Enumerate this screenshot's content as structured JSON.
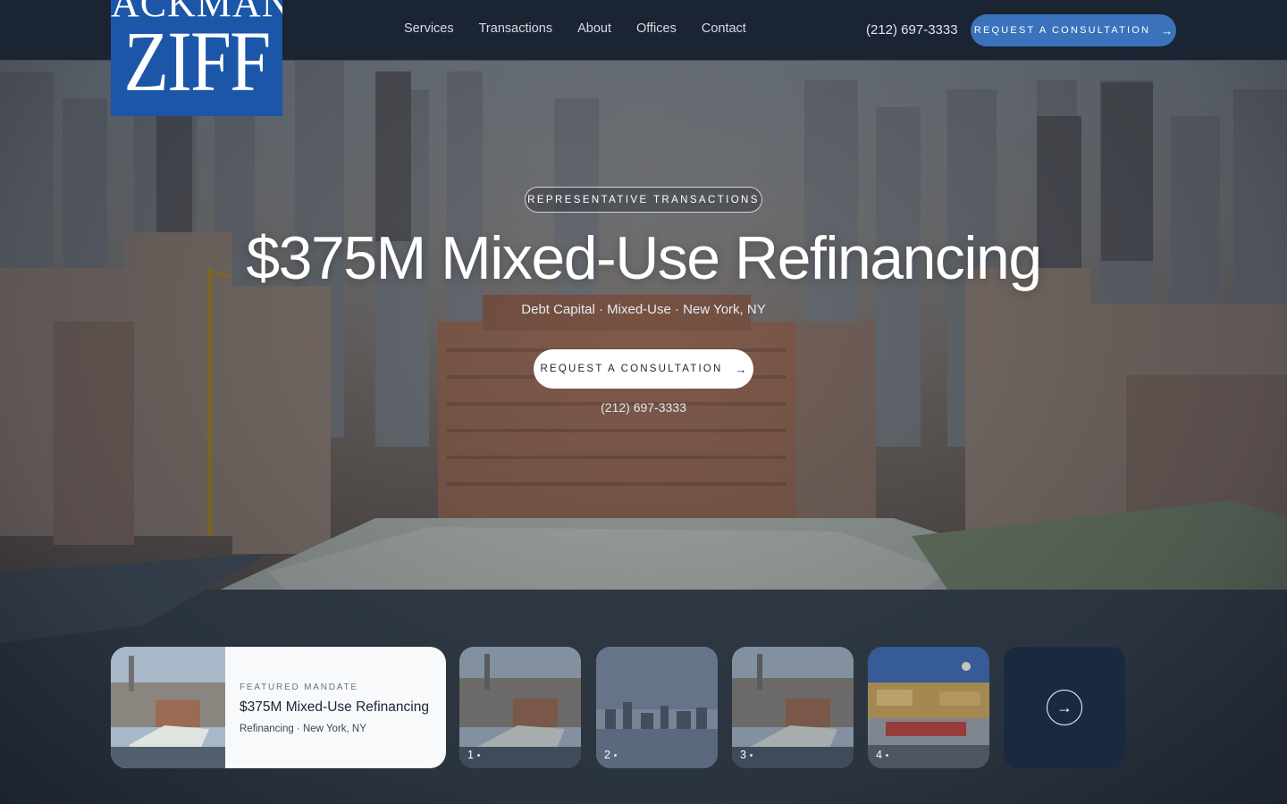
{
  "header": {
    "logo_top": "ACKMAN",
    "logo_main": "ZIFF",
    "nav": [
      {
        "label": "Services"
      },
      {
        "label": "Transactions"
      },
      {
        "label": "About"
      },
      {
        "label": "Offices"
      },
      {
        "label": "Contact"
      }
    ],
    "phone": "(212) 697-3333",
    "cta_label": "REQUEST A CONSULTATION",
    "cta_icon": "arrow-right-icon"
  },
  "hero": {
    "eyebrow": "REPRESENTATIVE TRANSACTIONS",
    "title": "$375M Mixed-Use Refinancing",
    "subtitle": "Debt Capital · Mixed-Use · New York, NY",
    "cta_label": "REQUEST A CONSULTATION",
    "phone": "(212) 697-3333"
  },
  "carousel": {
    "featured": {
      "eyebrow": "FEATURED MANDATE",
      "title": "$375M Mixed-Use Refinancing",
      "meta": "Refinancing · New York, NY"
    },
    "thumbs": [
      {
        "num": "1"
      },
      {
        "num": "2"
      },
      {
        "num": "3"
      },
      {
        "num": "4"
      }
    ],
    "next_icon": "arrow-right-icon",
    "next_glyph": "→"
  },
  "colors": {
    "header_bg": "#1a2433",
    "accent_blue": "#3a73bb",
    "logo_blue": "#1b56a8",
    "next_tile": "#1b2940"
  }
}
